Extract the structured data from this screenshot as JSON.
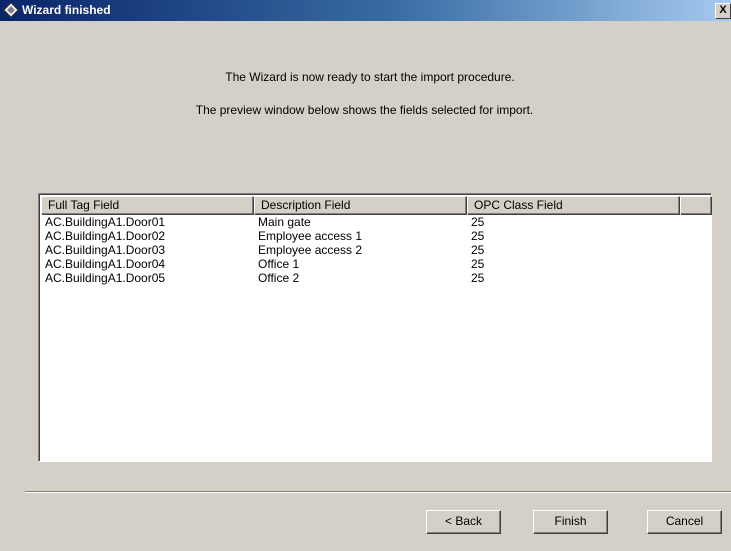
{
  "window": {
    "title": "Wizard finished",
    "close_label": "X"
  },
  "content": {
    "message_ready": "The Wizard is now ready to start the import procedure.",
    "message_preview": "The preview window below shows the fields selected for import."
  },
  "preview_table": {
    "columns": [
      "Full Tag Field",
      "Description Field",
      "OPC Class Field"
    ],
    "rows": [
      [
        "AC.BuildingA1.Door01",
        "Main gate",
        "25"
      ],
      [
        "AC.BuildingA1.Door02",
        "Employee access 1",
        "25"
      ],
      [
        "AC.BuildingA1.Door03",
        "Employee access 2",
        "25"
      ],
      [
        "AC.BuildingA1.Door04",
        "Office 1",
        "25"
      ],
      [
        "AC.BuildingA1.Door05",
        "Office 2",
        "25"
      ]
    ]
  },
  "buttons": {
    "back": "< Back",
    "finish": "Finish",
    "cancel": "Cancel"
  }
}
